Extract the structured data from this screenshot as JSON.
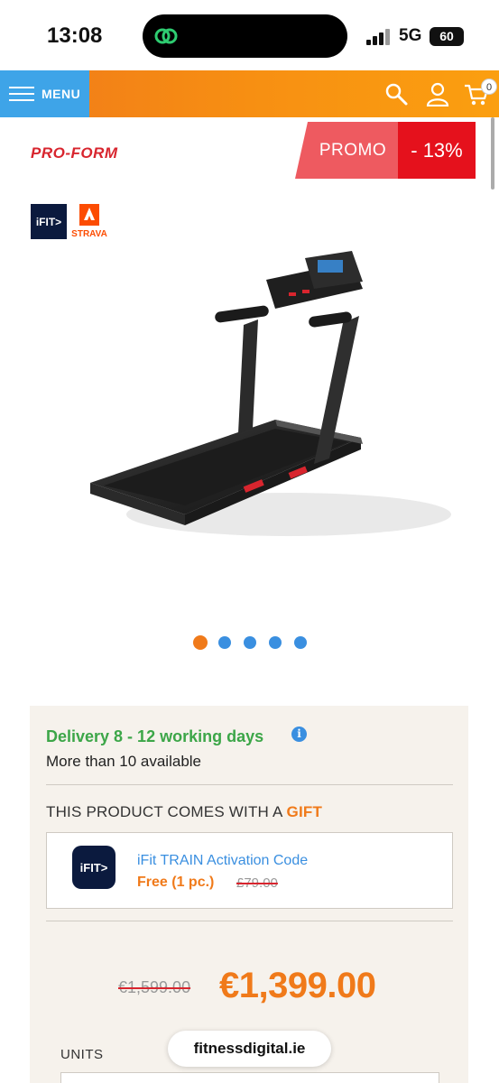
{
  "status_bar": {
    "time": "13:08",
    "network": "5G",
    "battery": "60"
  },
  "header": {
    "menu_label": "MENU",
    "search_icon": "search-icon",
    "account_icon": "user-icon",
    "cart_icon": "cart-icon",
    "cart_count": "0",
    "accent_color": "#f7901e",
    "menu_color": "#3ea4e8"
  },
  "brand": {
    "logo_text": "PRO-FORM",
    "promo_label": "PROMO",
    "discount": "- 13%"
  },
  "partners": {
    "ifit": "iFIT>",
    "strava": "STRAVA"
  },
  "carousel": {
    "slide_count": 5,
    "active_index": 0
  },
  "availability": {
    "delivery": "Delivery 8 - 12 working days",
    "stock": "More than 10 available"
  },
  "gift": {
    "heading_prefix": "THIS PRODUCT COMES WITH A ",
    "heading_accent": "GIFT",
    "logo_text": "iFIT>",
    "title": "iFit TRAIN Activation Code",
    "price": "Free (1 pc.)",
    "old_price": "£79.00"
  },
  "pricing": {
    "old_price": "€1,599.00",
    "current_price": "€1,399.00"
  },
  "units": {
    "label": "UNITS"
  },
  "browser": {
    "domain": "fitnessdigital.ie"
  }
}
